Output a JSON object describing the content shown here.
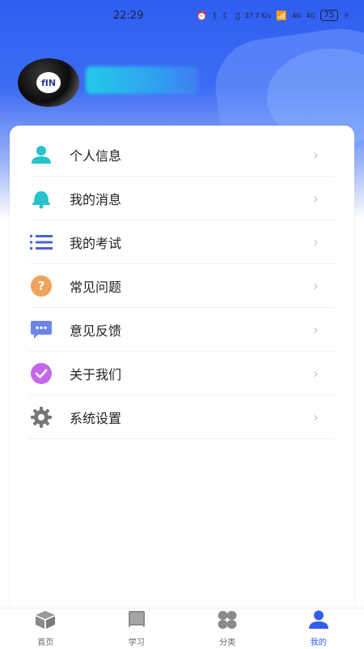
{
  "status_bar": {
    "time": "22:29",
    "network_speed": "37.7 K/s",
    "signal_1": "4G",
    "signal_2": "4G",
    "battery": "75"
  },
  "profile": {
    "avatar_text": "fIN"
  },
  "menu": {
    "items": [
      {
        "label": "个人信息",
        "icon": "user-icon"
      },
      {
        "label": "我的消息",
        "icon": "bell-icon"
      },
      {
        "label": "我的考试",
        "icon": "list-icon"
      },
      {
        "label": "常见问题",
        "icon": "question-icon"
      },
      {
        "label": "意见反馈",
        "icon": "feedback-icon"
      },
      {
        "label": "关于我们",
        "icon": "check-badge-icon"
      },
      {
        "label": "系统设置",
        "icon": "gear-icon"
      }
    ]
  },
  "tab_bar": {
    "tabs": [
      {
        "label": "首页",
        "icon": "box-icon"
      },
      {
        "label": "学习",
        "icon": "book-icon"
      },
      {
        "label": "分类",
        "icon": "grid-icon"
      },
      {
        "label": "我的",
        "icon": "person-icon",
        "active": true
      }
    ]
  },
  "colors": {
    "accent": "#2f5ef0",
    "user_icon": "#27c3c8",
    "bell_icon": "#27c3c8",
    "list_icon": "#4a63d8",
    "question_icon": "#f0a35a",
    "feedback_icon": "#6b86e8",
    "about_icon": "#c468e8",
    "gear_icon": "#777777"
  }
}
